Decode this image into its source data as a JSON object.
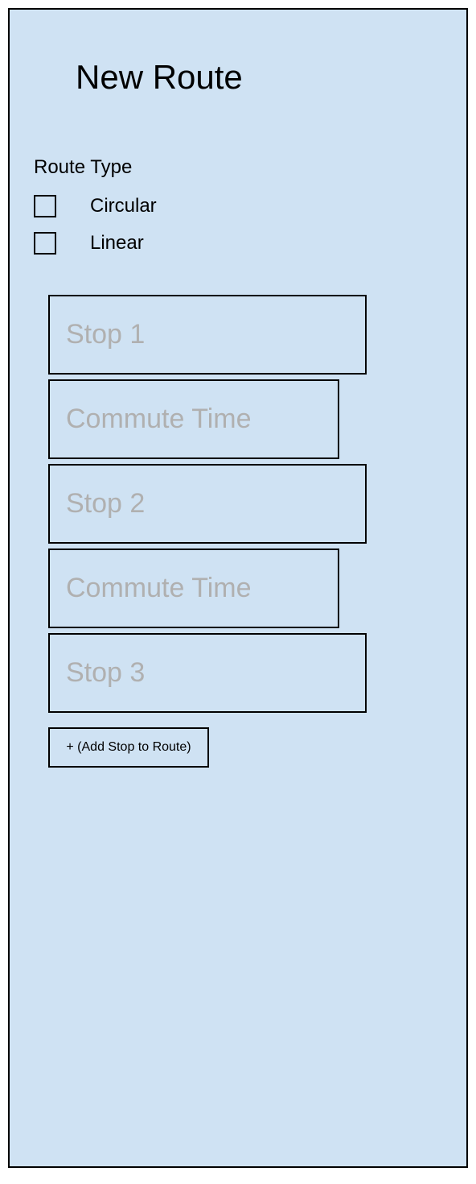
{
  "title": "New Route",
  "route_type": {
    "label": "Route Type",
    "options": [
      {
        "label": "Circular",
        "checked": false
      },
      {
        "label": "Linear",
        "checked": false
      }
    ]
  },
  "stops": {
    "fields": [
      {
        "placeholder": "Stop 1",
        "kind": "stop"
      },
      {
        "placeholder": "Commute Time",
        "kind": "commute"
      },
      {
        "placeholder": "Stop 2",
        "kind": "stop"
      },
      {
        "placeholder": "Commute Time",
        "kind": "commute"
      },
      {
        "placeholder": "Stop 3",
        "kind": "stop"
      }
    ]
  },
  "add_button_label": "+ (Add Stop to Route)"
}
